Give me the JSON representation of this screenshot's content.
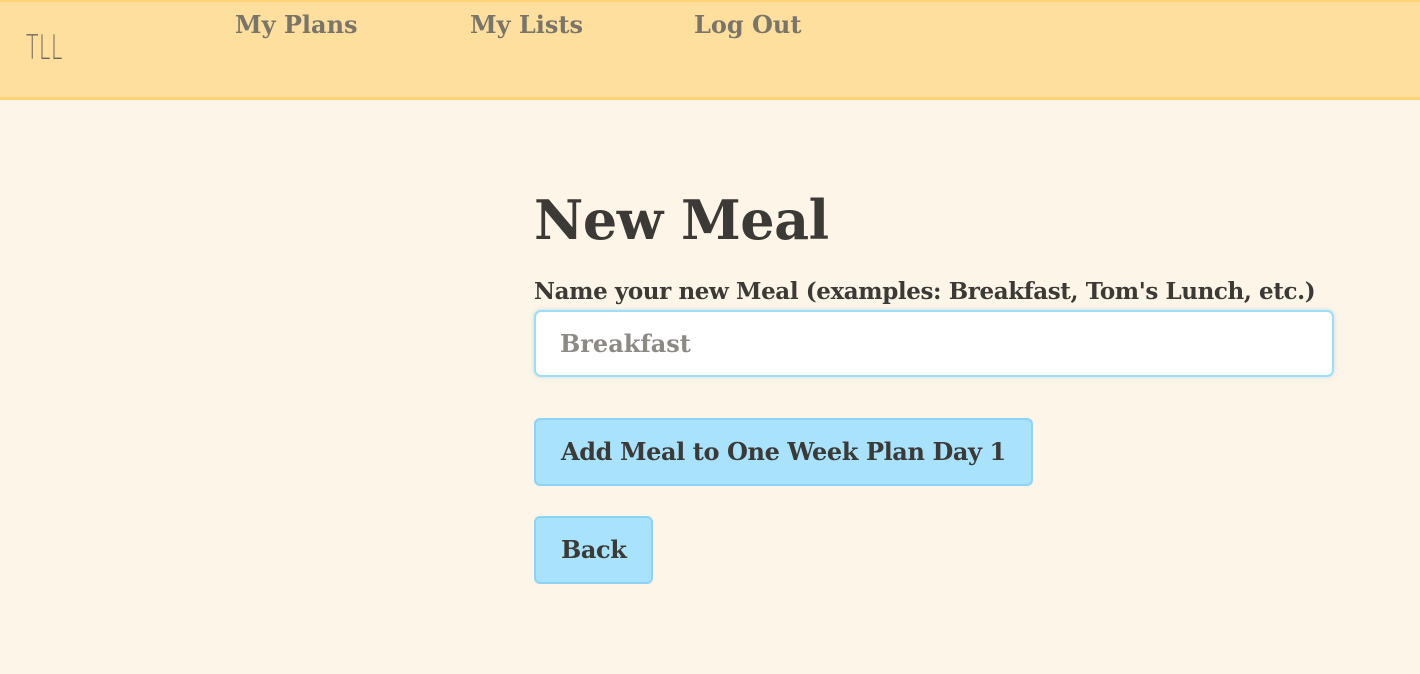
{
  "nav": {
    "brand": "TLL",
    "links": [
      {
        "label": "My Plans"
      },
      {
        "label": "My Lists"
      },
      {
        "label": "Log Out"
      }
    ]
  },
  "main": {
    "title": "New Meal",
    "name_label": "Name your new Meal (examples: Breakfast, Tom's Lunch, etc.)",
    "name_input": {
      "value": "",
      "placeholder": "Breakfast"
    },
    "submit_label": "Add Meal to One Week Plan Day 1",
    "back_label": "Back"
  },
  "colors": {
    "navbar_bg": "#ffdf9e",
    "page_bg": "#fdf5e8",
    "button_bg": "#a9e2fc",
    "text": "#3b3a36"
  }
}
